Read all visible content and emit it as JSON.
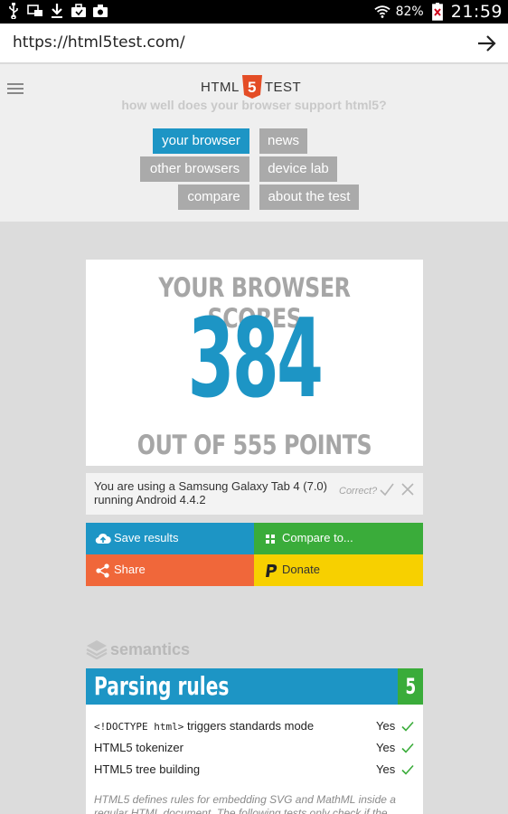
{
  "status_bar": {
    "battery_percent": "82%",
    "time": "21:59"
  },
  "url_bar": {
    "url": "https://html5test.com/"
  },
  "header": {
    "logo_left": "HTML",
    "logo_badge": "5",
    "logo_right": "TEST",
    "tagline": "how well does your browser support html5?",
    "nav": {
      "your_browser": "your browser",
      "news": "news",
      "other_browsers": "other browsers",
      "device_lab": "device lab",
      "compare": "compare",
      "about_the_test": "about the test"
    }
  },
  "score": {
    "heading": "YOUR BROWSER SCORES",
    "value": "384",
    "out_of": "OUT OF 555 POINTS"
  },
  "device": {
    "line1": "You are using a Samsung Galaxy Tab 4 (7.0)",
    "line2": "running Android 4.4.2",
    "correct_label": "Correct?"
  },
  "actions": {
    "save": "Save results",
    "compare": "Compare to...",
    "share": "Share",
    "donate": "Donate"
  },
  "colors": {
    "blue": "#1d95c5",
    "green": "#3aac3a",
    "orange": "#f0673a",
    "yellow": "#f7d000",
    "html5_orange": "#e44d26"
  },
  "semantics": {
    "category": "semantics",
    "section_title": "Parsing rules",
    "section_score": "5",
    "tests": [
      {
        "prefix": "<!DOCTYPE html>",
        "name": " triggers standards mode",
        "result": "Yes"
      },
      {
        "prefix": "",
        "name": "HTML5 tokenizer",
        "result": "Yes"
      },
      {
        "prefix": "",
        "name": "HTML5 tree building",
        "result": "Yes"
      }
    ],
    "note": "HTML5 defines rules for embedding SVG and MathML inside a regular HTML document. The following tests only check if the"
  }
}
